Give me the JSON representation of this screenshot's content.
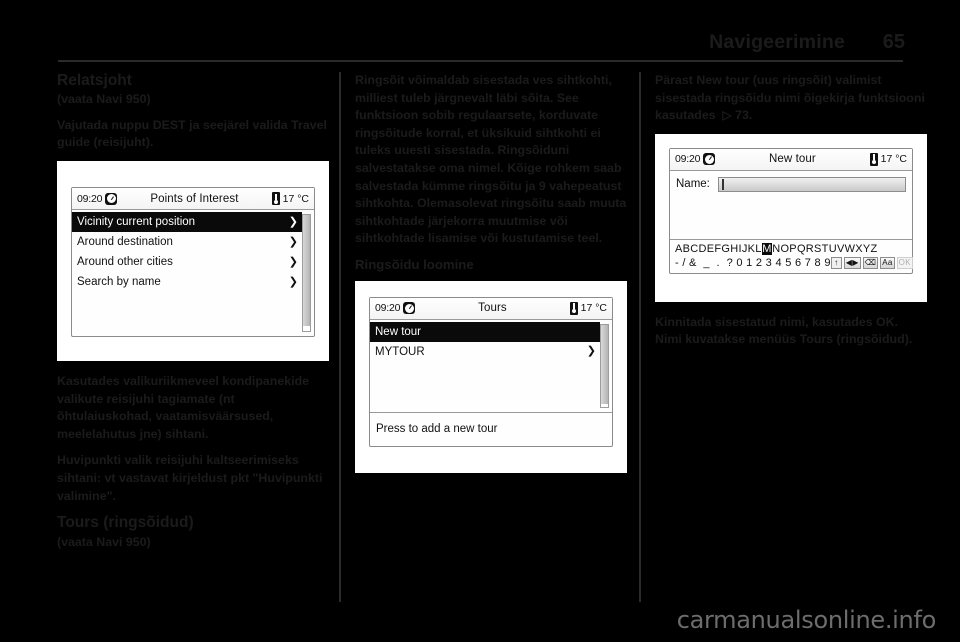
{
  "header": {
    "title": "Navigeerimine",
    "page_number": "65"
  },
  "watermark": "carmanualsonline.info",
  "column1": {
    "heading": "Relatsjoht",
    "subref": "(vaata Navi 950)",
    "para1": "Vajutada nuppu DEST ja seejärel valida Travel guide (reisijuht).",
    "figure_caption_after": "Kasutades valikuriikmeveel kondipanekide valikute reisijuhi tagiamate (nt õhtulaiuskohad, vaatamisväärsused, meelelahutus jne) sihtani.",
    "para2": "Huvipunkti valik reisijuhi kaltseerimiseks sihtani: vt vastavat kirjeldust pkt \"Huvipunkti valimine\".",
    "heading2": "Tours (ringsõidud)",
    "subref2": "(vaata Navi 950)"
  },
  "column2": {
    "para1": "Ringsõit võimaldab sisestada ves sihtkohti, milliest tuleb järgnevalt läbi sõita. See funktsioon sobib regulaarsete, korduvate ringsõitude korral, et üksikuid sihtkohti ei tuleks uuesti sisestada. Ringsõiduni salvestatakse oma nimel. Kõige rohkem saab salvestada kümme ringsõitu ja 9 vahepeatust sihtkohta. Olemasolevat ringsõitu saab muuta sihtkohtade järjekorra muutmise või sihtkohtade lisamise või kustutamise teel.",
    "heading": "Ringsõidu loomine"
  },
  "column3": {
    "para1": "Pärast New tour (uus ringsõit) valimist sisestada ringsõidu nimi õigekirja funktsiooni kasutades",
    "para1_ref": "73.",
    "para2": "Kinnitada sisestatud nimi, kasutades OK. Nimi kuvatakse menüüs Tours (ringsõidud)."
  },
  "screens": {
    "poi": {
      "time": "09:20",
      "title": "Points of Interest",
      "temp": "17 °C",
      "rows": [
        {
          "label": "Vicinity current position",
          "arrow": "❯",
          "selected": true
        },
        {
          "label": "Around destination",
          "arrow": "❯",
          "selected": false
        },
        {
          "label": "Around other cities",
          "arrow": "❯",
          "selected": false
        },
        {
          "label": "Search by name",
          "arrow": "❯",
          "selected": false
        }
      ]
    },
    "tours": {
      "time": "09:20",
      "title": "Tours",
      "temp": "17 °C",
      "rows": [
        {
          "label": "New tour",
          "arrow": "",
          "selected": true
        },
        {
          "label": "MYTOUR",
          "arrow": "❯",
          "selected": false
        }
      ],
      "footer": "Press to add a new tour"
    },
    "newtour": {
      "time": "09:20",
      "title": "New tour",
      "temp": "17 °C",
      "name_label": "Name:",
      "name_value": "",
      "keyboard_row1_pre": "ABCDEFGHIJKL",
      "keyboard_row1_highlight": "M",
      "keyboard_row1_post": "NOPQRSTUVWXYZ",
      "keyboard_row2": "- / &  _  .  ? 0 1 2 3 4 5 6 7 8 9",
      "keys": {
        "shift": "↑",
        "left_right": "◀▶",
        "backspace": "⌫",
        "case": "Aa",
        "ok": "OK"
      }
    }
  }
}
